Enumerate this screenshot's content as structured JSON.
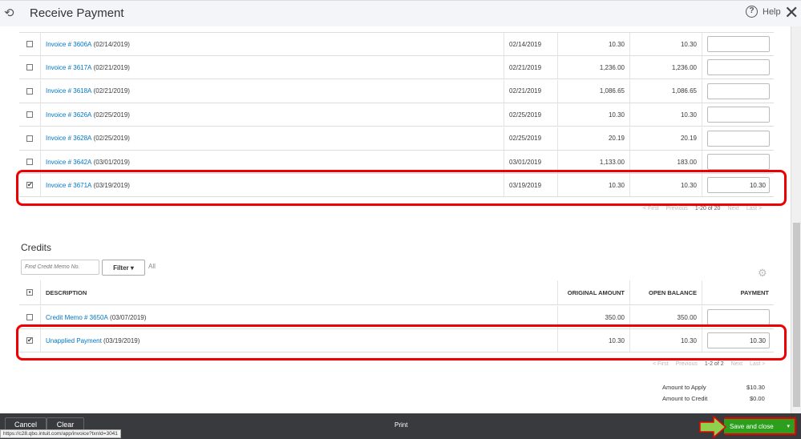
{
  "header": {
    "title": "Receive Payment",
    "help": "Help"
  },
  "invoices": [
    {
      "number": "Invoice # 3606A",
      "date_paren": " (02/14/2019)",
      "due": "02/14/2019",
      "original": "10.30",
      "open": "10.30",
      "payment": "",
      "checked": false
    },
    {
      "number": "Invoice # 3617A",
      "date_paren": " (02/21/2019)",
      "due": "02/21/2019",
      "original": "1,236.00",
      "open": "1,236.00",
      "payment": "",
      "checked": false
    },
    {
      "number": "Invoice # 3618A",
      "date_paren": " (02/21/2019)",
      "due": "02/21/2019",
      "original": "1,086.65",
      "open": "1,086.65",
      "payment": "",
      "checked": false
    },
    {
      "number": "Invoice # 3626A",
      "date_paren": " (02/25/2019)",
      "due": "02/25/2019",
      "original": "10.30",
      "open": "10.30",
      "payment": "",
      "checked": false
    },
    {
      "number": "Invoice # 3628A",
      "date_paren": " (02/25/2019)",
      "due": "02/25/2019",
      "original": "20.19",
      "open": "20.19",
      "payment": "",
      "checked": false
    },
    {
      "number": "Invoice # 3642A",
      "date_paren": " (03/01/2019)",
      "due": "03/01/2019",
      "original": "1,133.00",
      "open": "183.00",
      "payment": "",
      "checked": false
    },
    {
      "number": "Invoice # 3671A",
      "date_paren": " (03/19/2019)",
      "due": "03/19/2019",
      "original": "10.30",
      "open": "10.30",
      "payment": "10.30",
      "checked": true
    }
  ],
  "invoice_pager": {
    "first": "< First",
    "previous": "Previous",
    "range": "1-20 of 20",
    "next": "Next",
    "last": "Last >"
  },
  "credits": {
    "title": "Credits",
    "find_placeholder": "Find Credit Memo No.",
    "filter": "Filter ▾",
    "filter_value": "All",
    "headers": {
      "description": "DESCRIPTION",
      "original": "ORIGINAL AMOUNT",
      "open": "OPEN BALANCE",
      "payment": "PAYMENT"
    },
    "rows": [
      {
        "number": "Credit Memo # 3650A",
        "date_paren": " (03/07/2019)",
        "original": "350.00",
        "open": "350.00",
        "payment": "",
        "checked": false
      },
      {
        "number": "Unapplied Payment",
        "date_paren": " (03/19/2019)",
        "original": "10.30",
        "open": "10.30",
        "payment": "10.30",
        "checked": true
      }
    ],
    "pager": {
      "first": "< First",
      "previous": "Previous",
      "range": "1-2 of 2",
      "next": "Next",
      "last": "Last >"
    }
  },
  "totals": {
    "apply_label": "Amount to Apply",
    "apply_value": "$10.30",
    "credit_label": "Amount to Credit",
    "credit_value": "$0.00"
  },
  "footer": {
    "cancel": "Cancel",
    "clear": "Clear",
    "print": "Print",
    "save": "Save and close",
    "save_dd": "▾"
  },
  "status_url": "https://c28.qbo.intuit.com/app/invoice?txnId=3041"
}
